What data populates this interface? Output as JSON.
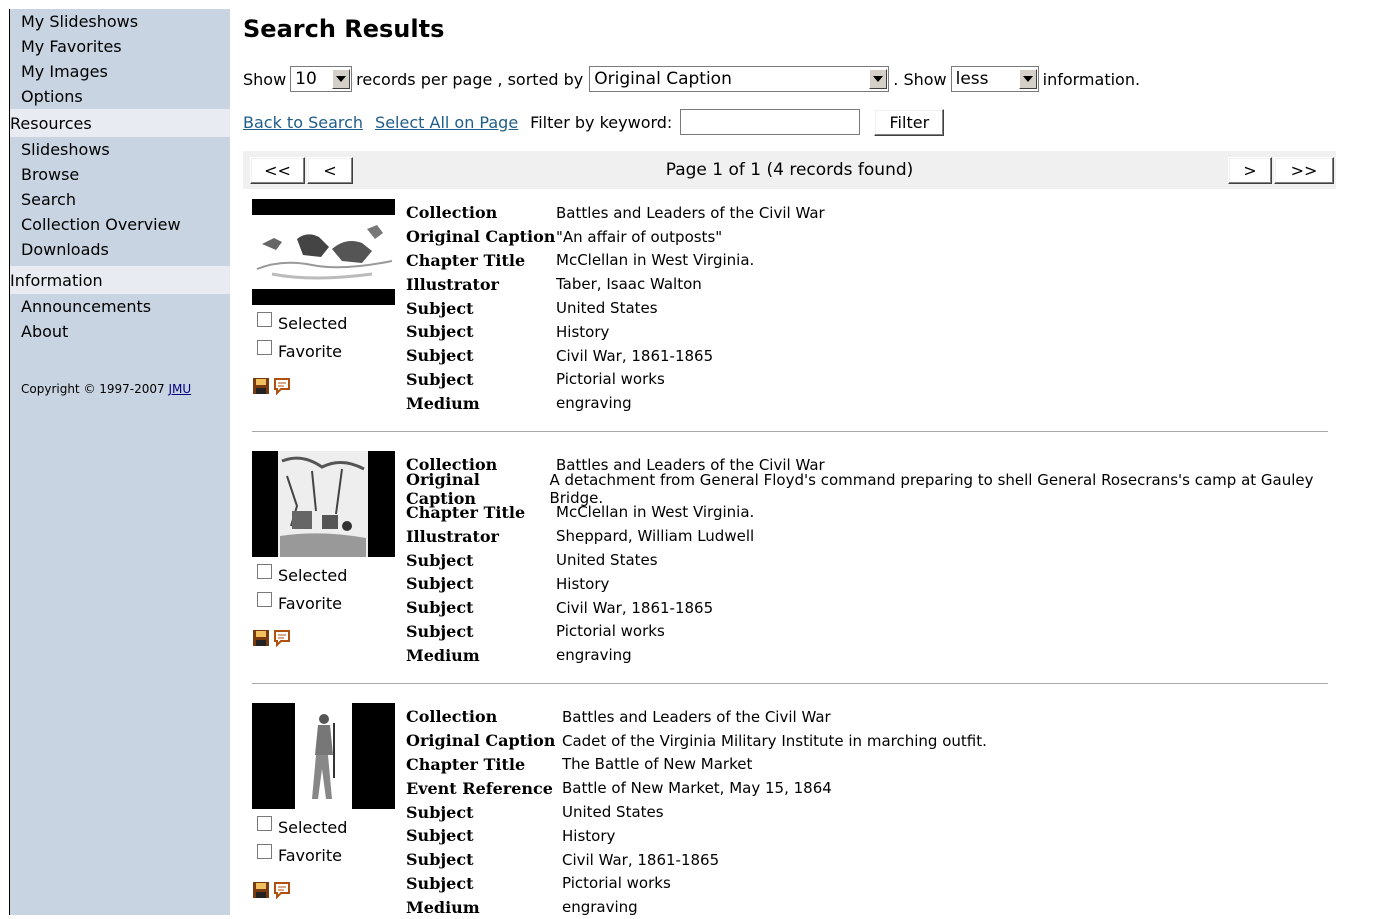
{
  "sidebar": {
    "top_items": [
      "My Slideshows",
      "My Favorites",
      "My Images",
      "Options"
    ],
    "resources_header": "Resources",
    "resources_items": [
      "Slideshows",
      "Browse",
      "Search",
      "Collection Overview",
      "Downloads"
    ],
    "information_header": "Information",
    "information_items": [
      "Announcements",
      "About"
    ],
    "copyright_text": "Copyright © 1997-2007 ",
    "copyright_link": "JMU"
  },
  "page": {
    "title": "Search Results",
    "show_label": "Show",
    "per_page_value": "10",
    "records_per_page_label": "records per page , sorted by",
    "sort_value": "Original Caption",
    "show2_label": ". Show",
    "info_value": "less",
    "information_label": "information.",
    "back_link": "Back to Search",
    "select_all_link": "Select All on Page",
    "filter_label": "Filter by keyword:",
    "filter_placeholder": "",
    "filter_button": "Filter"
  },
  "pager": {
    "first": "<<",
    "prev": "<",
    "text": "Page 1 of 1 (4 records found)",
    "next": ">",
    "last": ">>"
  },
  "labels": {
    "selected": "Selected",
    "favorite": "Favorite"
  },
  "icons": {
    "save": "floppy-disk-icon",
    "comment": "speech-bubble-icon"
  },
  "records": [
    {
      "fields": [
        [
          "Collection",
          "Battles and Leaders of the Civil War"
        ],
        [
          "Original Caption",
          "\"An affair of outposts\""
        ],
        [
          "Chapter Title",
          "McClellan in West Virginia."
        ],
        [
          "Illustrator",
          "Taber, Isaac Walton"
        ],
        [
          "Subject",
          "United States"
        ],
        [
          "Subject",
          "History"
        ],
        [
          "Subject",
          "Civil War, 1861-1865"
        ],
        [
          "Subject",
          "Pictorial works"
        ],
        [
          "Medium",
          "engraving"
        ]
      ]
    },
    {
      "fields": [
        [
          "Collection",
          "Battles and Leaders of the Civil War"
        ],
        [
          "Original Caption",
          "A detachment from General Floyd's command preparing to shell General Rosecrans's camp at Gauley Bridge."
        ],
        [
          "Chapter Title",
          "McClellan in West Virginia."
        ],
        [
          "Illustrator",
          "Sheppard, William Ludwell"
        ],
        [
          "Subject",
          "United States"
        ],
        [
          "Subject",
          "History"
        ],
        [
          "Subject",
          "Civil War, 1861-1865"
        ],
        [
          "Subject",
          "Pictorial works"
        ],
        [
          "Medium",
          "engraving"
        ]
      ]
    },
    {
      "fields": [
        [
          "Collection",
          "Battles and Leaders of the Civil War"
        ],
        [
          "Original Caption",
          "Cadet of the Virginia Military Institute in marching outfit."
        ],
        [
          "Chapter Title",
          "The Battle of New Market"
        ],
        [
          "Event Reference",
          "Battle of New Market, May 15, 1864"
        ],
        [
          "Subject",
          "United States"
        ],
        [
          "Subject",
          "History"
        ],
        [
          "Subject",
          "Civil War, 1861-1865"
        ],
        [
          "Subject",
          "Pictorial works"
        ],
        [
          "Medium",
          "engraving"
        ]
      ]
    }
  ]
}
